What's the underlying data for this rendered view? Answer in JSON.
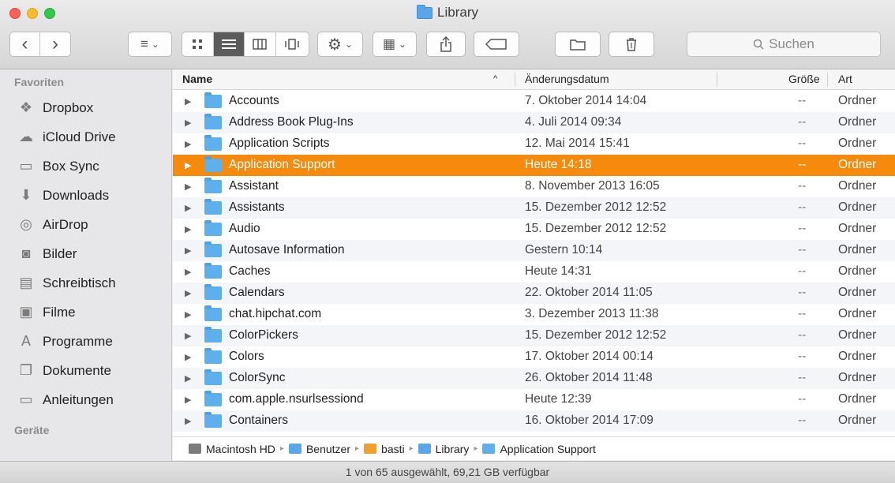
{
  "window": {
    "title": "Library"
  },
  "toolbar": {
    "back": "‹",
    "forward": "›",
    "arrange_icon": "≡",
    "action_icon": "⚙",
    "group_icon": "▦",
    "share_icon": "⇧",
    "tag_icon": "◯",
    "newfolder_icon": "▭",
    "delete_icon": "🗑",
    "chevron": "⌄",
    "search_placeholder": "Suchen"
  },
  "sidebar": {
    "favorites_header": "Favoriten",
    "devices_header": "Geräte",
    "items": [
      {
        "label": "Dropbox",
        "icon": "❖"
      },
      {
        "label": "iCloud Drive",
        "icon": "☁"
      },
      {
        "label": "Box Sync",
        "icon": "▭"
      },
      {
        "label": "Downloads",
        "icon": "⬇"
      },
      {
        "label": "AirDrop",
        "icon": "◎"
      },
      {
        "label": "Bilder",
        "icon": "◙"
      },
      {
        "label": "Schreibtisch",
        "icon": "▤"
      },
      {
        "label": "Filme",
        "icon": "▣"
      },
      {
        "label": "Programme",
        "icon": "A"
      },
      {
        "label": "Dokumente",
        "icon": "❐"
      },
      {
        "label": "Anleitungen",
        "icon": "▭"
      }
    ]
  },
  "columns": {
    "name": "Name",
    "sort_indicator": "^",
    "date": "Änderungsdatum",
    "size": "Größe",
    "kind": "Art"
  },
  "files": [
    {
      "name": "Accounts",
      "date": "7. Oktober 2014 14:04",
      "size": "--",
      "kind": "Ordner"
    },
    {
      "name": "Address Book Plug-Ins",
      "date": "4. Juli 2014 09:34",
      "size": "--",
      "kind": "Ordner"
    },
    {
      "name": "Application Scripts",
      "date": "12. Mai 2014 15:41",
      "size": "--",
      "kind": "Ordner"
    },
    {
      "name": "Application Support",
      "date": "Heute 14:18",
      "size": "--",
      "kind": "Ordner"
    },
    {
      "name": "Assistant",
      "date": "8. November 2013 16:05",
      "size": "--",
      "kind": "Ordner"
    },
    {
      "name": "Assistants",
      "date": "15. Dezember 2012 12:52",
      "size": "--",
      "kind": "Ordner"
    },
    {
      "name": "Audio",
      "date": "15. Dezember 2012 12:52",
      "size": "--",
      "kind": "Ordner"
    },
    {
      "name": "Autosave Information",
      "date": "Gestern 10:14",
      "size": "--",
      "kind": "Ordner"
    },
    {
      "name": "Caches",
      "date": "Heute 14:31",
      "size": "--",
      "kind": "Ordner"
    },
    {
      "name": "Calendars",
      "date": "22. Oktober 2014 11:05",
      "size": "--",
      "kind": "Ordner"
    },
    {
      "name": "chat.hipchat.com",
      "date": "3. Dezember 2013 11:38",
      "size": "--",
      "kind": "Ordner"
    },
    {
      "name": "ColorPickers",
      "date": "15. Dezember 2012 12:52",
      "size": "--",
      "kind": "Ordner"
    },
    {
      "name": "Colors",
      "date": "17. Oktober 2014 00:14",
      "size": "--",
      "kind": "Ordner"
    },
    {
      "name": "ColorSync",
      "date": "26. Oktober 2014 11:48",
      "size": "--",
      "kind": "Ordner"
    },
    {
      "name": "com.apple.nsurlsessiond",
      "date": "Heute 12:39",
      "size": "--",
      "kind": "Ordner"
    },
    {
      "name": "Containers",
      "date": "16. Oktober 2014 17:09",
      "size": "--",
      "kind": "Ordner"
    }
  ],
  "selected_index": 3,
  "pathbar": {
    "items": [
      "Macintosh HD",
      "Benutzer",
      "basti",
      "Library",
      "Application Support"
    ],
    "separator": "▸"
  },
  "status": {
    "text": "1 von 65 ausgewählt, 69,21 GB verfügbar"
  },
  "colors": {
    "selection": "#f68a0d",
    "folder": "#5db0ec"
  }
}
